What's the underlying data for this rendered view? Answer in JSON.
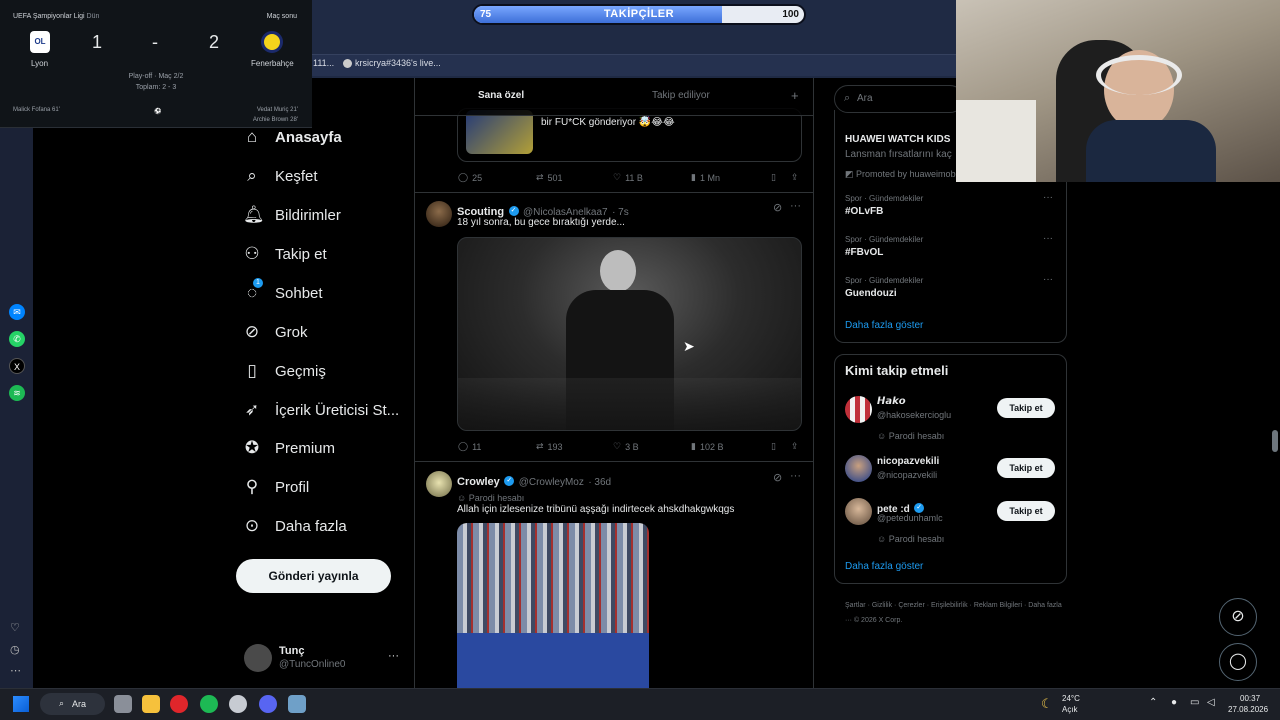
{
  "scoreboard": {
    "league": "UEFA Şampiyonlar Ligi",
    "when": "Dün",
    "status": "Maç sonu",
    "home": "Lyon",
    "away": "Fenerbahçe",
    "home_score": "1",
    "dash": "-",
    "away_score": "2",
    "round": "Play-off · Maç 2/2",
    "aggregate": "Toplam: 2 - 3",
    "home_scorer": "Malick Fofana 61'",
    "away_scorer_1": "Vedat Muriç 21'",
    "away_scorer_2": "Archie Brown 28'"
  },
  "follower_bar": {
    "label": "TAKİPÇİLER",
    "current": "75",
    "goal": "100",
    "progress": 0.75
  },
  "browser_tabs": {
    "tab1": "111...",
    "tab2": "krsicrya#3436's live..."
  },
  "nav": {
    "items": [
      {
        "label": "Anasayfa",
        "icon": "home-icon"
      },
      {
        "label": "Keşfet",
        "icon": "search-icon"
      },
      {
        "label": "Bildirimler",
        "icon": "bell-icon"
      },
      {
        "label": "Takip et",
        "icon": "follow-icon"
      },
      {
        "label": "Sohbet",
        "icon": "chat-icon",
        "badge": "1"
      },
      {
        "label": "Grok",
        "icon": "grok-icon"
      },
      {
        "label": "Geçmiş",
        "icon": "bookmark-icon"
      },
      {
        "label": "İçerik Üreticisi St...",
        "icon": "rocket-icon"
      },
      {
        "label": "Premium",
        "icon": "verified-icon"
      },
      {
        "label": "Profil",
        "icon": "person-icon"
      },
      {
        "label": "Daha fazla",
        "icon": "more-icon"
      }
    ],
    "post_button": "Gönderi yayınla",
    "account": {
      "name": "Tunç",
      "handle": "@TuncOnline0"
    }
  },
  "feed": {
    "tabs": [
      "Sana özel",
      "Takip ediliyor"
    ],
    "add_tab": "+",
    "post0": {
      "text": "bir FU*CK gönderiyor 🤯😂😂",
      "replies": "25",
      "reposts": "501",
      "likes": "11 B",
      "views": "1 Mn"
    },
    "post1": {
      "name": "Scouting",
      "handle": "@NicolasAnelkaa7",
      "time": "· 7s",
      "text": "18 yıl sonra, bu gece bıraktığı yerde...",
      "replies": "11",
      "reposts": "193",
      "likes": "3 B",
      "views": "102 B"
    },
    "post2": {
      "name": "Crowley",
      "handle": "@CrowleyMoz",
      "time": "· 36d",
      "badge": "Parodi hesabı",
      "text": "Allah için izlesenize tribünü aşşağı indirtecek ahskdhakgwkqgs"
    }
  },
  "right": {
    "search_placeholder": "Ara",
    "ad": {
      "title": "HUAWEI WATCH KIDS",
      "subtitle": "Lansman fırsatlarını kaç",
      "promoted": "Promoted by huaweimob"
    },
    "trends": [
      {
        "category": "Spor · Gündemdekiler",
        "name": "#OLvFB"
      },
      {
        "category": "Spor · Gündemdekiler",
        "name": "#FBvOL"
      },
      {
        "category": "Spor · Gündemdekiler",
        "name": "Guendouzi"
      }
    ],
    "show_more": "Daha fazla göster",
    "who_to_follow": {
      "title": "Kimi takip etmeli",
      "users": [
        {
          "name": "𝙃𝙖𝙠𝙤",
          "handle": "@hakosekercioglu",
          "badge": "Parodi hesabı"
        },
        {
          "name": "nicopazvekili",
          "handle": "@nicopazvekili",
          "badge": ""
        },
        {
          "name": "pete :d",
          "handle": "@petedunhamlc",
          "badge": "Parodi hesabı"
        }
      ],
      "button": "Takip et",
      "show_more": "Daha fazla göster"
    },
    "footer": [
      "Şartlar",
      "Gizlilik",
      "Çerezler",
      "Erişilebilirlik",
      "Reklam Bilgileri",
      "Daha fazla ···",
      "© 2026 X Corp."
    ]
  },
  "taskbar": {
    "search": "Ara",
    "weather_temp": "24°C",
    "weather_desc": "Açık",
    "time": "00:37",
    "date": "27.08.2026"
  },
  "colors": {
    "accent": "#1d9bf0",
    "background": "#000000",
    "border": "#2f3336"
  }
}
